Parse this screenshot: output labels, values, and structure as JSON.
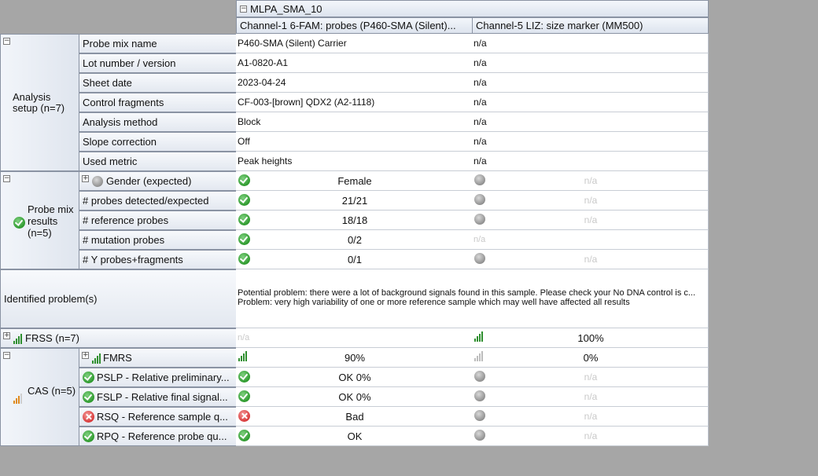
{
  "header": {
    "sample": "MLPA_SMA_10",
    "channel1": "Channel-1  6-FAM:  probes  (P460-SMA  (Silent)...",
    "channel5": "Channel-5 LIZ: size marker (MM500)"
  },
  "analysis_setup": {
    "title": "Analysis setup (n=7)",
    "rows": [
      {
        "label": "Probe mix name",
        "c1": "P460-SMA (Silent) Carrier",
        "c5": "n/a"
      },
      {
        "label": "Lot number / version",
        "c1": "A1-0820-A1",
        "c5": "n/a"
      },
      {
        "label": "Sheet date",
        "c1": "2023-04-24",
        "c5": "n/a"
      },
      {
        "label": "Control fragments",
        "c1": "CF-003-[brown] QDX2 (A2-1118)",
        "c5": "n/a"
      },
      {
        "label": "Analysis method",
        "c1": "Block",
        "c5": "n/a"
      },
      {
        "label": "Slope correction",
        "c1": "Off",
        "c5": "n/a"
      },
      {
        "label": "Used metric",
        "c1": "Peak heights",
        "c5": "n/a"
      }
    ]
  },
  "probe_mix": {
    "title": "Probe mix results (n=5)",
    "rows": [
      {
        "label": "Gender (expected)",
        "c1": "Female",
        "c5": "n/a"
      },
      {
        "label": "# probes detected/expected",
        "c1": "21/21",
        "c5": "n/a"
      },
      {
        "label": "# reference probes",
        "c1": "18/18",
        "c5": "n/a"
      },
      {
        "label": "# mutation probes",
        "c1": "0/2",
        "c5": "n/a"
      },
      {
        "label": "# Y probes+fragments",
        "c1": "0/1",
        "c5": "n/a"
      }
    ]
  },
  "identified": {
    "label": "Identified problem(s)",
    "line1": "Potential problem: there were a lot of background signals found in this sample. Please check your No DNA control is c...",
    "line2": "Problem:  very high variability of one or more reference sample which may well have affected all results"
  },
  "frss": {
    "label": "FRSS (n=7)",
    "c1": "n/a",
    "c5": "100%"
  },
  "cas": {
    "title": "CAS (n=5)",
    "rows": [
      {
        "label": "FMRS",
        "c1": "90%",
        "c5": "0%"
      },
      {
        "label": "PSLP  - Relative preliminary...",
        "c1": "OK 0%",
        "c5": "n/a"
      },
      {
        "label": "FSLP  - Relative final signal...",
        "c1": "OK 0%",
        "c5": "n/a"
      },
      {
        "label": "RSQ  - Reference sample q...",
        "c1": "Bad",
        "c5": "n/a"
      },
      {
        "label": "RPQ  - Reference probe qu...",
        "c1": "OK",
        "c5": "n/a"
      }
    ]
  },
  "icons": {
    "ok": "check-circle-icon",
    "fail": "x-circle-icon",
    "unknown": "grey-circle-icon",
    "signal": "signal-bars-icon"
  },
  "colors": {
    "ok": "#2e9a2e",
    "fail": "#d83a3a",
    "bars_green": "#2f8f2f",
    "bars_orange": "#e08a1e"
  }
}
